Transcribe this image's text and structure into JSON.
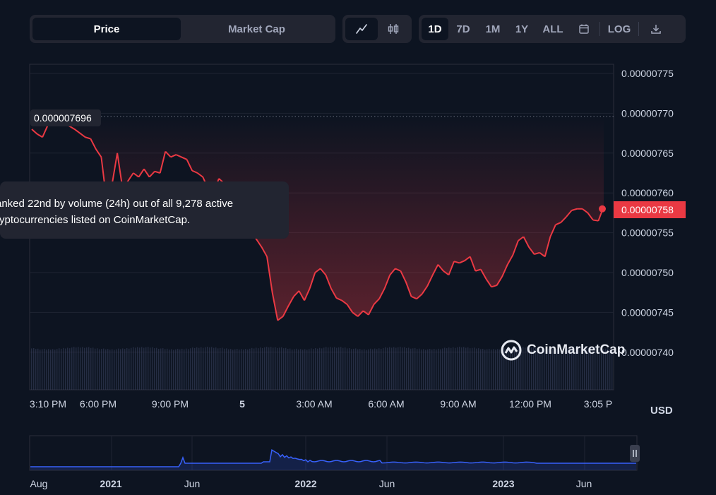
{
  "toolbar": {
    "metric_tabs": [
      "Price",
      "Market Cap"
    ],
    "active_metric": "Price",
    "chart_type_icons": [
      "line-chart-icon",
      "candlestick-icon"
    ],
    "ranges": [
      "1D",
      "7D",
      "1M",
      "1Y",
      "ALL"
    ],
    "active_range": "1D",
    "scale_label": "LOG",
    "calendar_icon": "calendar-icon",
    "download_icon": "download-icon"
  },
  "tooltip": {
    "line1": "anked 22nd by volume (24h) out of all 9,278 active",
    "line2": "ryptocurrencies listed on CoinMarketCap."
  },
  "high_label": "0.000007696",
  "current_price_label": "0.00000758",
  "currency": "USD",
  "watermark": "CoinMarketCap",
  "colors": {
    "down": "#ea3943",
    "up": "#16c784",
    "navigator": "#3861fb",
    "panel": "#222531",
    "background": "#0d1421"
  },
  "chart_data": {
    "type": "line",
    "y_ticks": [
      "0.00000775",
      "0.00000770",
      "0.00000765",
      "0.00000760",
      "0.00000755",
      "0.00000750",
      "0.00000745",
      "0.00000740"
    ],
    "ylim": [
      7.4e-06,
      7.76e-06
    ],
    "x_ticks": [
      "3:10 PM",
      "6:00 PM",
      "9:00 PM",
      "5",
      "3:00 AM",
      "6:00 AM",
      "9:00 AM",
      "12:00 PM",
      "3:05 P"
    ],
    "reference_high": 7.696e-06,
    "last_value": 7.58e-06,
    "series": [
      {
        "values": [
          7.68e-06,
          7.674e-06,
          7.67e-06,
          7.685e-06,
          7.696e-06,
          7.692e-06,
          7.688e-06,
          7.684e-06,
          7.68e-06,
          7.675e-06,
          7.67e-06,
          7.668e-06,
          7.655e-06,
          7.645e-06,
          7.59e-06,
          7.61e-06,
          7.65e-06,
          7.605e-06,
          7.615e-06,
          7.625e-06,
          7.62e-06,
          7.63e-06,
          7.62e-06,
          7.627e-06,
          7.625e-06,
          7.652e-06,
          7.645e-06,
          7.648e-06,
          7.645e-06,
          7.642e-06,
          7.628e-06,
          7.625e-06,
          7.62e-06,
          7.605e-06,
          7.6e-06,
          7.618e-06,
          7.612e-06,
          7.61e-06,
          7.6e-06,
          7.58e-06,
          7.57e-06,
          7.55e-06,
          7.542e-06,
          7.532e-06,
          7.52e-06,
          7.475e-06,
          7.44e-06,
          7.445e-06,
          7.458e-06,
          7.47e-06,
          7.477e-06,
          7.465e-06,
          7.48e-06,
          7.5e-06,
          7.505e-06,
          7.497e-06,
          7.48e-06,
          7.468e-06,
          7.465e-06,
          7.46e-06,
          7.45e-06,
          7.445e-06,
          7.452e-06,
          7.447e-06,
          7.46e-06,
          7.467e-06,
          7.48e-06,
          7.497e-06,
          7.505e-06,
          7.502e-06,
          7.488e-06,
          7.47e-06,
          7.467e-06,
          7.473e-06,
          7.483e-06,
          7.497e-06,
          7.51e-06,
          7.502e-06,
          7.497e-06,
          7.514e-06,
          7.512e-06,
          7.515e-06,
          7.52e-06,
          7.502e-06,
          7.504e-06,
          7.492e-06,
          7.482e-06,
          7.484e-06,
          7.495e-06,
          7.51e-06,
          7.522e-06,
          7.54e-06,
          7.545e-06,
          7.532e-06,
          7.523e-06,
          7.525e-06,
          7.52e-06,
          7.545e-06,
          7.56e-06,
          7.563e-06,
          7.57e-06,
          7.578e-06,
          7.58e-06,
          7.58e-06,
          7.575e-06,
          7.566e-06,
          7.565e-06,
          7.583e-06
        ]
      }
    ]
  },
  "navigator": {
    "labels": [
      "Aug",
      "2021",
      "Jun",
      "2022",
      "Jun",
      "2023",
      "Jun"
    ],
    "handle_icon": "pause-icon"
  }
}
